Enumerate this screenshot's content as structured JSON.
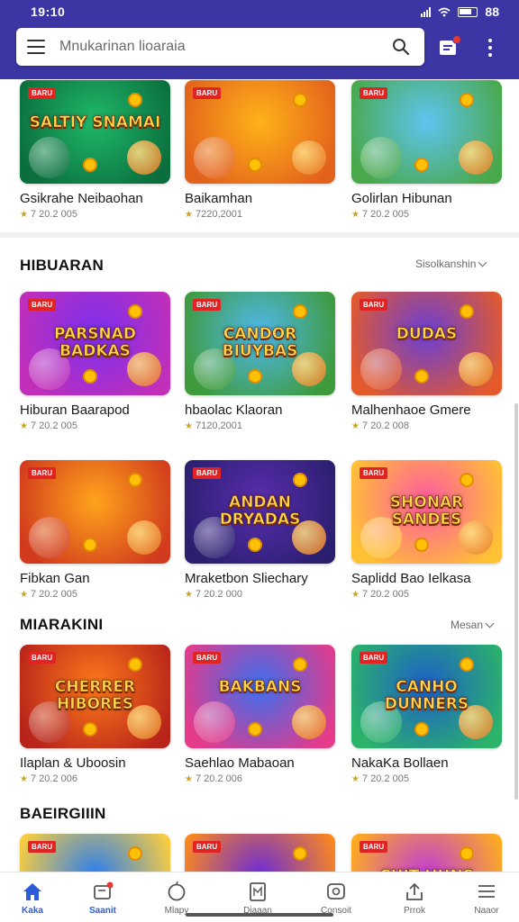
{
  "status": {
    "time": "19:10",
    "battery": "88"
  },
  "search": {
    "placeholder": "Mnukarinan lioaraia"
  },
  "top_row": [
    {
      "tag": "BARU",
      "art": "SALTIY SNAMAI",
      "title": "Gsikrahe Neibaohan",
      "meta": "7 20.2 005",
      "c1": "#1fb86a",
      "c2": "#0b6e3d"
    },
    {
      "tag": "BARU",
      "art": "",
      "title": "Baikamhan",
      "meta": "7220,2001",
      "c1": "#ffb21a",
      "c2": "#e2611b"
    },
    {
      "tag": "BARU",
      "art": "",
      "title": "Golirlan Hibunan",
      "meta": "7 20.2 005",
      "c1": "#5ec4f0",
      "c2": "#49a84a"
    }
  ],
  "sections": [
    {
      "heading": "HIBUARAN",
      "more": "Sisolkanshin"
    },
    {
      "heading": "MIARAKINI",
      "more": "Mesan"
    },
    {
      "heading": "BAEIRGIIIN"
    }
  ],
  "grid": [
    {
      "tag": "BARU",
      "art": "PARSNAD BADKAS",
      "title": "Hiburan Baarapod",
      "meta": "7 20.2 005",
      "c1": "#7b2ff0",
      "c2": "#c22fb8"
    },
    {
      "tag": "BARU",
      "art": "CANDOR BIUYBAS",
      "title": "hbaolac Klaoran",
      "meta": "7120,2001",
      "c1": "#4fb8ee",
      "c2": "#3e9a3a"
    },
    {
      "tag": "BARU",
      "art": "DUDAS",
      "title": "Malhenhaoe Gmere",
      "meta": "7 20.2 008",
      "c1": "#6a3fd6",
      "c2": "#e45a2b"
    },
    {
      "tag": "BARU",
      "art": "",
      "title": "Fibkan Gan",
      "meta": "7 20.2 005",
      "c1": "#ffa41b",
      "c2": "#d13a1d"
    },
    {
      "tag": "BARU",
      "art": "ANDAN DRYADAS",
      "title": "Mraketbon Sliechary",
      "meta": "7 20.2 000",
      "c1": "#5a2db0",
      "c2": "#2a1f6e"
    },
    {
      "tag": "BARU",
      "art": "SHONAR SANDES",
      "title": "Saplidd Bao Ielkasa",
      "meta": "7 20.2 005",
      "c1": "#ff5aa0",
      "c2": "#ffc234"
    },
    {
      "tag": "BARU",
      "art": "CHERRER HIBORES",
      "title": "Ilaplan & Uboosin",
      "meta": "7 20.2 006",
      "c1": "#ff7a1a",
      "c2": "#b8241a"
    },
    {
      "tag": "BARU",
      "art": "BAKBANS",
      "title": "Saehlao Mabaoan",
      "meta": "7 20.2 006",
      "c1": "#3b6ff0",
      "c2": "#e63a8a"
    },
    {
      "tag": "BARU",
      "art": "CANHO DUNNERS",
      "title": "NakaKa Bollaen",
      "meta": "7 20.2 005",
      "c1": "#1e5fc8",
      "c2": "#2bb36a"
    },
    {
      "tag": "BARU",
      "art": "",
      "title": "",
      "meta": "",
      "c1": "#2a7ef0",
      "c2": "#ffcf3a"
    },
    {
      "tag": "BARU",
      "art": "",
      "title": "",
      "meta": "",
      "c1": "#6a2bd8",
      "c2": "#ff8a1a"
    },
    {
      "tag": "BARU",
      "art": "CUIT HUNS",
      "title": "",
      "meta": "",
      "c1": "#c23ad8",
      "c2": "#ffb01a"
    }
  ],
  "nav": [
    {
      "label": "Kaka",
      "icon": "home-icon"
    },
    {
      "label": "Saanit",
      "icon": "store-icon"
    },
    {
      "label": "Mlapy",
      "icon": "clock-icon"
    },
    {
      "label": "Diaaan",
      "icon": "document-icon"
    },
    {
      "label": "Consoit",
      "icon": "camera-icon"
    },
    {
      "label": "Prrok",
      "icon": "share-icon"
    },
    {
      "label": "Naaor",
      "icon": "menu-icon"
    }
  ],
  "colors": {
    "brand": "#3b36a3",
    "nav_active": "#2e5bd8",
    "badge": "#e02424"
  }
}
